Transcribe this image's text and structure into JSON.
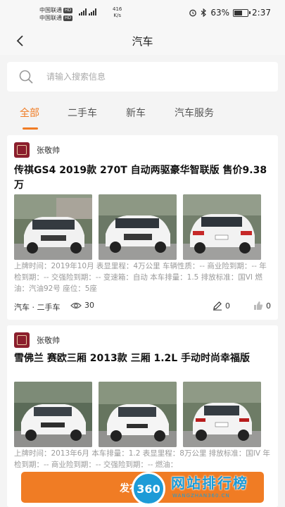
{
  "statusbar": {
    "carrier1": "中国联通",
    "carrier2": "中国联通",
    "hd": "HD",
    "net_speed": "416",
    "net_unit": "K/s",
    "battery": "63%",
    "battery_level": 0.63,
    "time": "2:37"
  },
  "nav": {
    "title": "汽车"
  },
  "search": {
    "placeholder": "请输入搜索信息"
  },
  "tabs": [
    {
      "label": "全部",
      "active": true
    },
    {
      "label": "二手车",
      "active": false
    },
    {
      "label": "新车",
      "active": false
    },
    {
      "label": "汽车服务",
      "active": false
    }
  ],
  "posts": [
    {
      "author": "张敬帅",
      "title": "传祺GS4 2019款 270T 自动两驱豪华智联版 售价9.38万",
      "description": "上牌时间：2019年10月 表显里程：4万公里 车辆性质：-- 商业险到期：-- 年检到期：-- 交强险到期：-- 变速箱：自动 本车排量：1.5 排放标准：国VI 燃油：汽油92号 座位：5座",
      "category": "汽车 · 二手车",
      "views": "30",
      "comments": "0",
      "likes": "0"
    },
    {
      "author": "张敬帅",
      "title": "雪佛兰 赛欧三厢 2013款 三厢 1.2L 手动时尚幸福版",
      "description": "上牌时间：2013年6月 本车排量：1.2 表显里程：8万公里 排放标准：国IV 年检到期：-- 商业险到期：-- 交强险到期：-- 燃油："
    }
  ],
  "publish": {
    "label": "发布"
  },
  "watermark": {
    "num": "360",
    "text": "网站排行榜",
    "sub": "WANGZHAN360.CN"
  },
  "colors": {
    "accent": "#f07c24"
  }
}
